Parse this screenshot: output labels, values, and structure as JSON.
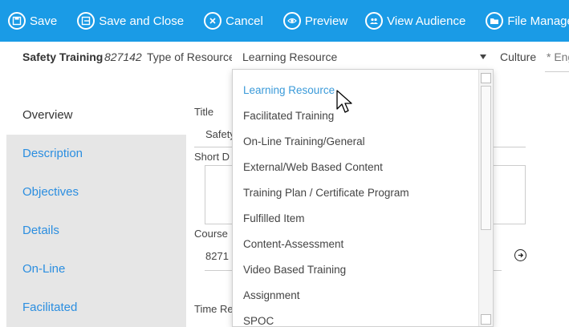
{
  "toolbar": {
    "save": "Save",
    "save_close": "Save and Close",
    "cancel": "Cancel",
    "preview": "Preview",
    "view_audience": "View Audience",
    "file_manager": "File Manager"
  },
  "header": {
    "course_name": "Safety Training",
    "course_id": "827142",
    "type_label": "Type of Resource",
    "type_value": "Learning Resource",
    "culture_label": "Culture",
    "culture_value": "* Eng"
  },
  "nav": {
    "items": [
      "Overview",
      "Description",
      "Objectives",
      "Details",
      "On-Line",
      "Facilitated"
    ]
  },
  "form": {
    "title_label": "Title",
    "title_value": "Safety",
    "short_desc_label": "Short D",
    "course_label": "Course",
    "course_value": "8271",
    "time_label": "Time Re"
  },
  "dropdown": {
    "options": [
      "Learning Resource",
      "Facilitated Training",
      "On-Line Training/General",
      "External/Web Based Content",
      "Training Plan / Certificate Program",
      "Fulfilled Item",
      "Content-Assessment",
      "Video Based Training",
      "Assignment",
      "SPOC"
    ],
    "selected": "Learning Resource"
  },
  "colors": {
    "toolbar_bg": "#1a9be6",
    "link_blue": "#2b8ee0",
    "selected_option": "#3a9ad9",
    "nav_bg": "#e6e6e6"
  }
}
